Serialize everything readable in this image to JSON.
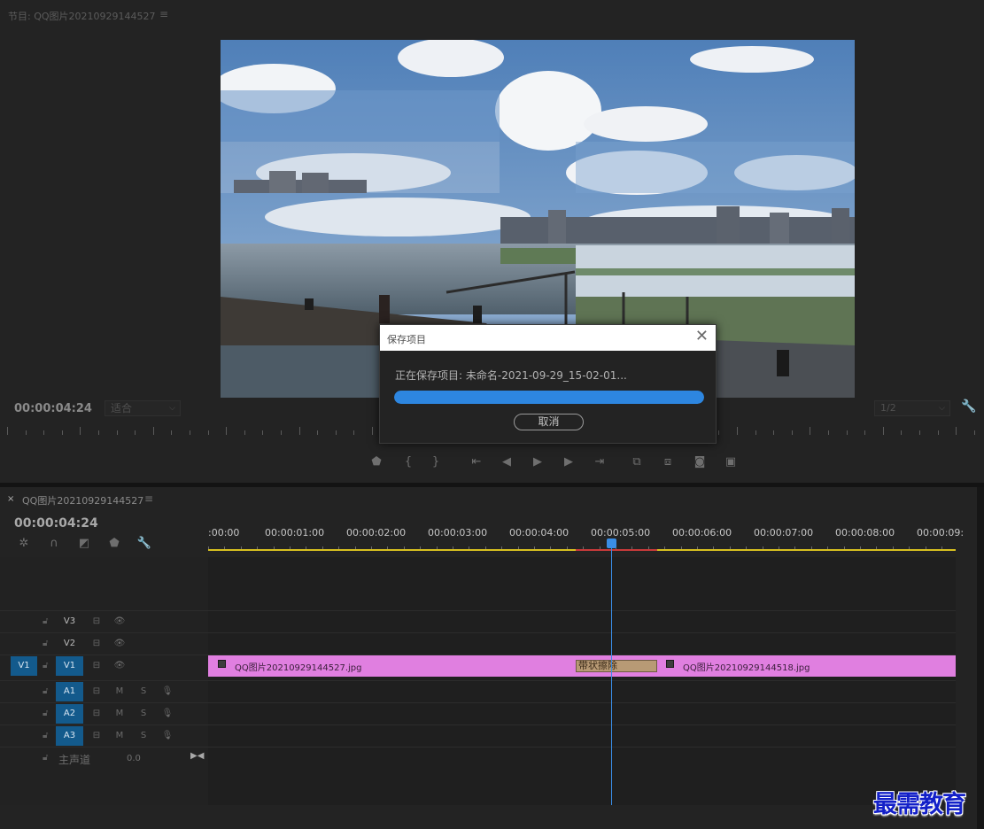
{
  "program": {
    "title": "节目: QQ图片20210929144527",
    "menu_glyph": "≡",
    "timecode": "00:00:04:24",
    "fit_label": "适合",
    "resolution_label": "1/2"
  },
  "dialog": {
    "title": "保存项目",
    "message": "正在保存项目: 未命名-2021-09-29_15-02-01...",
    "progress": 1.0,
    "cancel_label": "取消"
  },
  "sequence": {
    "close_glyph": "×",
    "title": "QQ图片20210929144527",
    "menu_glyph": "≡",
    "timecode": "00:00:04:24",
    "ruler_labels": [
      ":00:00",
      "00:00:01:00",
      "00:00:02:00",
      "00:00:03:00",
      "00:00:04:00",
      "00:00:05:00",
      "00:00:06:00",
      "00:00:07:00",
      "00:00:08:00",
      "00:00:09:"
    ],
    "tracks": {
      "v3": "V3",
      "v2": "V2",
      "v1": "V1",
      "v1_source": "V1",
      "a1": "A1",
      "a2": "A2",
      "a3": "A3",
      "m_label": "M",
      "s_label": "S"
    },
    "master_label": "主声道",
    "master_value": "0.0",
    "clips": {
      "clip1": "QQ图片20210929144527.jpg",
      "transition": "带状擦除",
      "clip2": "QQ图片20210929144518.jpg"
    }
  },
  "watermark": "最需教育",
  "colors": {
    "accent": "#2d86e0",
    "clip": "#e07fe0",
    "track_target": "#135a8c",
    "playhead": "#3a8ee6"
  }
}
